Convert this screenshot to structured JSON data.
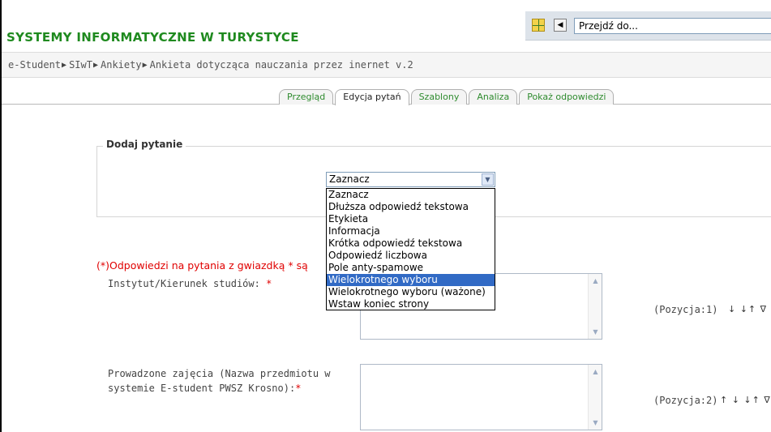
{
  "header": {
    "site_title": "SYSTEMY INFORMATYCZNE W TURYSTYCE",
    "jump_to": "Przejdź do..."
  },
  "breadcrumb": [
    {
      "label": "e-Student"
    },
    {
      "label": "SIwT"
    },
    {
      "label": "Ankiety"
    },
    {
      "label": "Ankieta dotycząca nauczania przez inernet v.2"
    }
  ],
  "tabs": [
    {
      "label": "Przegląd",
      "active": false
    },
    {
      "label": "Edycja pytań",
      "active": true
    },
    {
      "label": "Szablony",
      "active": false
    },
    {
      "label": "Analiza",
      "active": false
    },
    {
      "label": "Pokaż odpowiedzi",
      "active": false
    }
  ],
  "add_question": {
    "legend": "Dodaj pytanie",
    "select_value": "Zaznacz",
    "options": [
      "Zaznacz",
      "Dłuższa odpowiedź tekstowa",
      "Etykieta",
      "Informacja",
      "Krótka odpowiedź tekstowa",
      "Odpowiedź liczbowa",
      "Pole anty-spamowe",
      "Wielokrotnego wyboru",
      "Wielokrotnego wyboru (ważone)",
      "Wstaw koniec strony"
    ],
    "highlighted_index": 7
  },
  "required_note": "(*)Odpowiedzi na pytania z gwiazdką * są",
  "questions": [
    {
      "label_lines": [
        "Instytut/Kierunek studiów: "
      ],
      "star": "*",
      "position": "(Pozycja:1)",
      "move_icons": "↓ ↓↑ ∇"
    },
    {
      "label_lines": [
        "Prowadzone zajęcia (Nazwa przedmiotu w",
        "systemie E-student PWSZ Krosno):"
      ],
      "star": "*",
      "position": "(Pozycja:2)",
      "move_icons": "↑ ↓ ↓↑ ∇"
    }
  ],
  "colors": {
    "title_green": "#1f8a1f",
    "required_red": "#e00000",
    "highlight_blue": "#316ac5"
  }
}
